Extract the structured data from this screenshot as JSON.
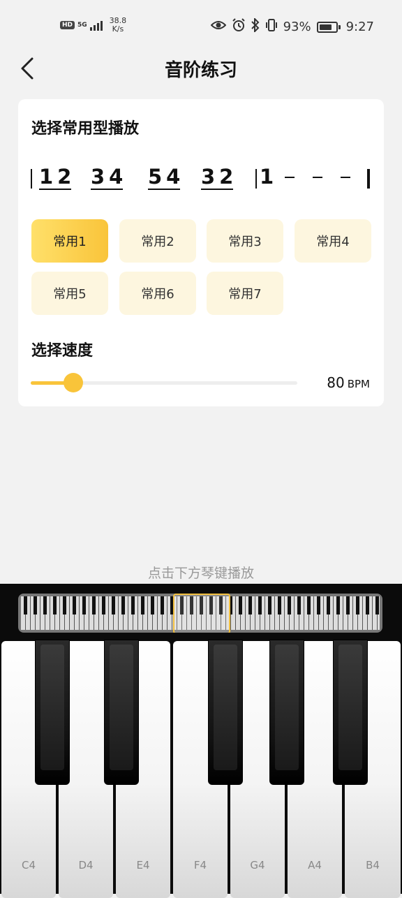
{
  "status": {
    "hd": "HD",
    "signal_label": "5G",
    "net_speed": "38.8",
    "net_unit": "K/s",
    "battery": "93%",
    "time": "9:27"
  },
  "header": {
    "title": "音阶练习"
  },
  "card": {
    "section_title": "选择常用型播放",
    "notation": {
      "groups": [
        "12",
        "34",
        "54",
        "32"
      ],
      "final": "1"
    },
    "presets": [
      "常用1",
      "常用2",
      "常用3",
      "常用4",
      "常用5",
      "常用6",
      "常用7"
    ],
    "selected_preset": "常用1",
    "speed_title": "选择速度",
    "speed_value": "80",
    "speed_unit": "BPM",
    "speed_fraction": 0.16
  },
  "hint": "点击下方琴键播放",
  "piano": {
    "white_keys": [
      "C4",
      "D4",
      "E4",
      "F4",
      "G4",
      "A4",
      "B4"
    ]
  },
  "colors": {
    "accent": "#f9c43a",
    "preset_bg": "#fdf6df"
  }
}
